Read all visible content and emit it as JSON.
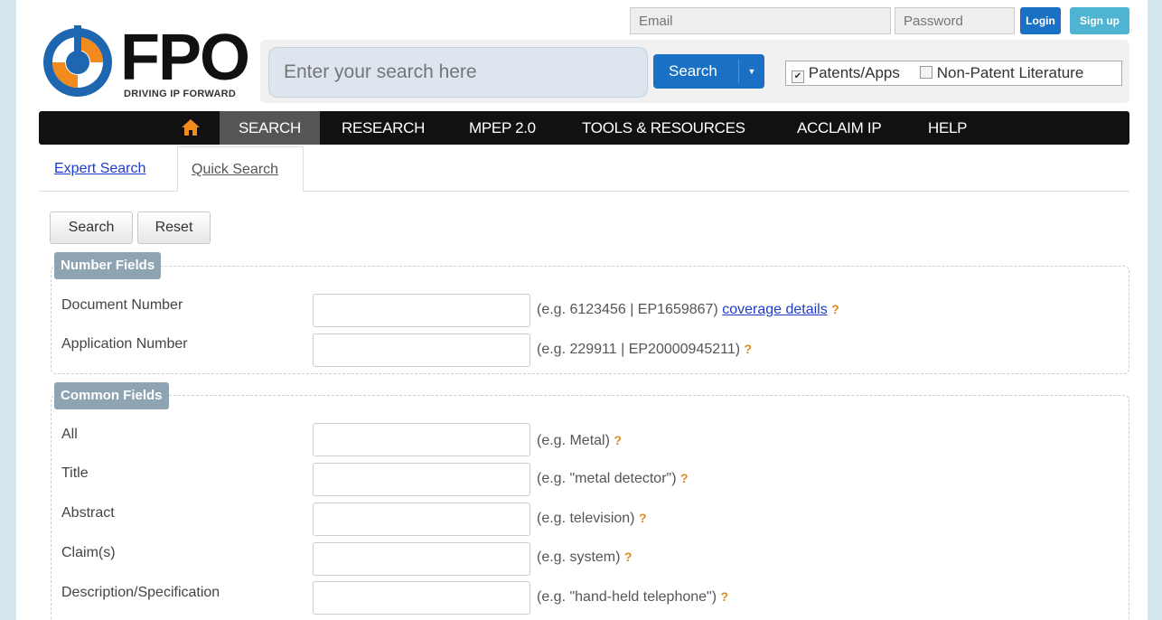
{
  "auth": {
    "email_placeholder": "Email",
    "password_placeholder": "Password",
    "login_label": "Login",
    "signup_label": "Sign up"
  },
  "logo": {
    "text": "FPO",
    "tagline": "DRIVING IP FORWARD"
  },
  "search": {
    "placeholder": "Enter your search here",
    "button_label": "Search",
    "dropdown_arrow": "▼",
    "options": [
      {
        "label": "Patents/Apps",
        "checked": true
      },
      {
        "label": "Non-Patent Literature",
        "checked": false
      }
    ]
  },
  "nav": {
    "home_icon": "home-icon",
    "items": [
      "SEARCH",
      "RESEARCH",
      "MPEP 2.0",
      "TOOLS & RESOURCES",
      "ACCLAIM IP",
      "HELP"
    ],
    "active": "SEARCH"
  },
  "tabs": {
    "expert": "Expert Search",
    "quick": "Quick Search",
    "active": "Quick Search"
  },
  "actions": {
    "search": "Search",
    "reset": "Reset"
  },
  "number_fields": {
    "legend": "Number Fields",
    "doc_label": "Document Number",
    "doc_hint": "(e.g. 6123456 | EP1659867)",
    "doc_link": "coverage details",
    "app_label": "Application Number",
    "app_hint": "(e.g. 229911 | EP20000945211)",
    "help_mark": "?"
  },
  "common_fields": {
    "legend": "Common Fields",
    "rows": [
      {
        "label": "All",
        "hint": "(e.g. Metal)",
        "help": "?"
      },
      {
        "label": "Title",
        "hint": "(e.g. \"metal detector\")",
        "help": "?"
      },
      {
        "label": "Abstract",
        "hint": "(e.g. television)",
        "help": "?"
      },
      {
        "label": "Claim(s)",
        "hint": "(e.g. system)",
        "help": "?"
      },
      {
        "label": "Description/Specification",
        "hint": "(e.g. \"hand-held telephone\")",
        "help": "?"
      }
    ]
  },
  "colors": {
    "nav_bg": "#111111",
    "nav_active_bg": "#555555",
    "login": "#1a70c4",
    "signup": "#4fb3d2",
    "legend_bg": "#8fa4b3",
    "help_mark": "#e08a1e",
    "logo_blue": "#1f66b0",
    "logo_orange": "#f28b1e"
  }
}
